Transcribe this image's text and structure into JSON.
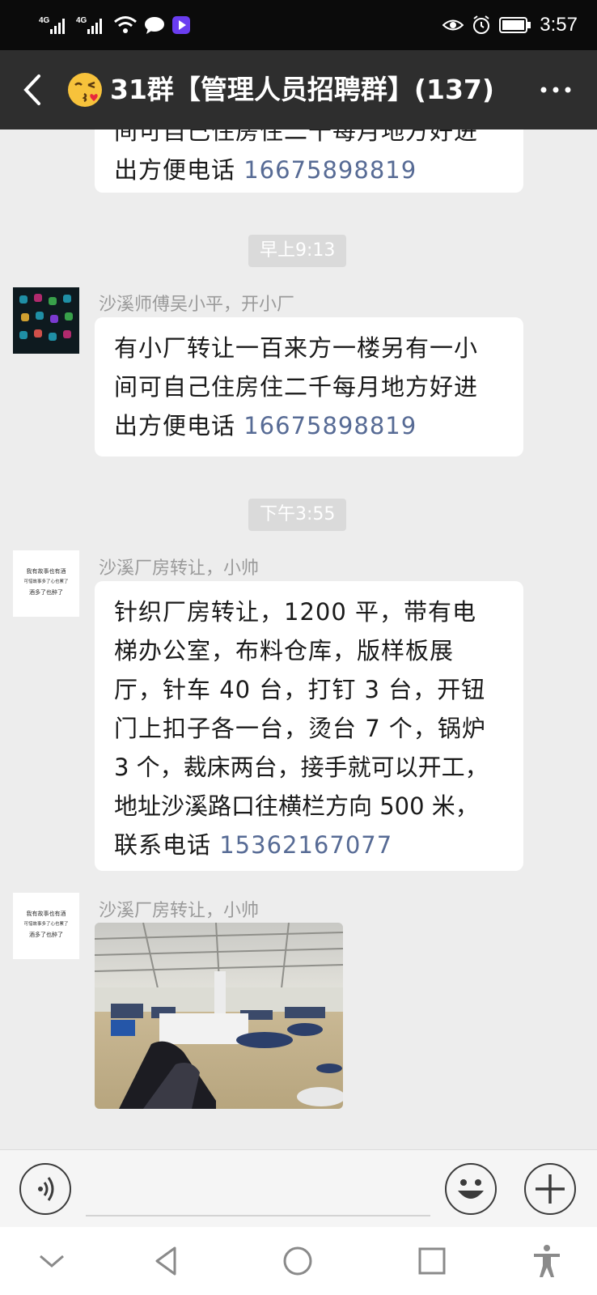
{
  "status_bar": {
    "network_1": "4G",
    "network_2": "4G",
    "time": "3:57"
  },
  "header": {
    "title": "31群【管理人员招聘群】(137)",
    "back_icon": "back-chevron-icon",
    "more_icon": "more-dots-icon",
    "emoji": "kissing-face-emoji"
  },
  "messages": {
    "m0": {
      "line1": "间可自己住房住二千每月地方好进",
      "line2": "出方便电话 ",
      "phone": "16675898819"
    },
    "t1": "早上9:13",
    "m1": {
      "sender": "沙溪师傅吴小平，开小厂",
      "line1": "有小厂转让一百来方一楼另有一小",
      "line2": "间可自己住房住二千每月地方好进",
      "line3": "出方便电话 ",
      "phone": "16675898819"
    },
    "t2": "下午3:55",
    "m2": {
      "sender": "沙溪厂房转让，小帅",
      "lines": [
        "针织厂房转让，1200 平，带有电",
        "梯办公室，布料仓库，版样板展",
        "厅，针车 40 台，打钉 3 台，开钮",
        "门上扣子各一台，烫台 7 个，锅炉",
        "3 个，裁床两台，接手就可以开工，",
        "地址沙溪路口往横栏方向 500 米，"
      ],
      "last_line": "联系电话 ",
      "phone": "15362167077"
    },
    "m3": {
      "sender": "沙溪厂房转让，小帅"
    },
    "avatar_text": {
      "l1": "我有故事也有酒",
      "l2": "可惜故事多了心也累了",
      "l3": "酒多了也醉了"
    }
  },
  "input_bar": {
    "voice_icon": "voice-icon",
    "emoji_icon": "emoji-icon",
    "plus_icon": "plus-icon"
  },
  "nav_bar": {
    "hide_icon": "chevron-down-icon",
    "back_icon": "triangle-back-icon",
    "home_icon": "circle-home-icon",
    "recent_icon": "square-recent-icon",
    "accessibility_icon": "accessibility-icon"
  }
}
